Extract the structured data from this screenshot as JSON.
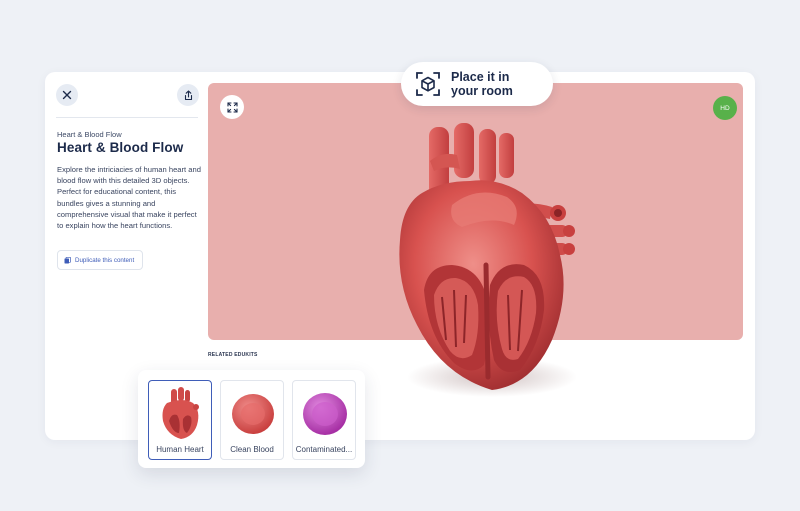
{
  "sidebar": {
    "close_icon": "close-icon",
    "share_icon": "share-icon",
    "breadcrumb": "Heart & Blood Flow",
    "title": "Heart & Blood Flow",
    "description": "Explore the intriciacies of human heart and blood flow with this detailed 3D objects. Perfect for educational content, this bundles gives a stunning and comprehensive visual that make it perfect to explain how the heart functions.",
    "duplicate_label": "Duplicate this content",
    "duplicate_icon": "copy-icon"
  },
  "viewer": {
    "expand_icon": "expand-icon",
    "quality_badge": "HD",
    "ar_button_line1": "Place it in",
    "ar_button_line2": "your room",
    "ar_icon": "ar-cube-icon",
    "background_color": "#e8afad",
    "model_name": "Human Heart"
  },
  "related": {
    "label": "RELATED EDUKITS",
    "items": [
      {
        "label": "Human Heart",
        "thumbnail": "heart-thumbnail",
        "selected": true
      },
      {
        "label": "Clean Blood",
        "thumbnail": "red-blood-cell-thumbnail",
        "selected": false
      },
      {
        "label": "Contaminated...",
        "thumbnail": "purple-blood-cell-thumbnail",
        "selected": false
      }
    ]
  },
  "colors": {
    "accent": "#3f5db8",
    "hd_badge": "#58b14a",
    "title": "#1c2a4a"
  }
}
